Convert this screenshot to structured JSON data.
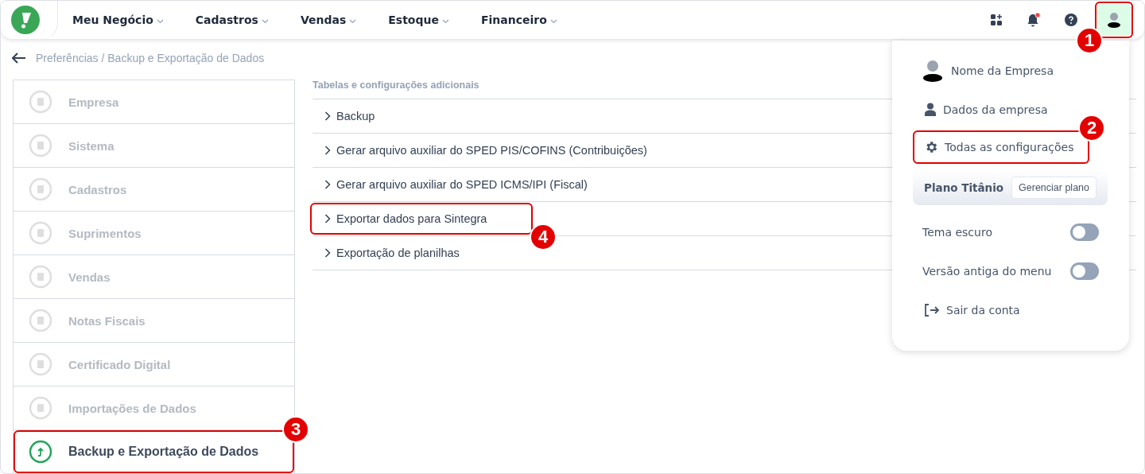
{
  "topbar": {
    "nav": [
      {
        "label": "Meu Negócio"
      },
      {
        "label": "Cadastros"
      },
      {
        "label": "Vendas"
      },
      {
        "label": "Estoque"
      },
      {
        "label": "Financeiro"
      }
    ],
    "notification_unread": true,
    "avatar_callout": "1"
  },
  "breadcrumb": "Preferências / Backup e Exportação de Dados",
  "sidebar": {
    "items": [
      {
        "label": "Empresa",
        "selected": false
      },
      {
        "label": "Sistema",
        "selected": false
      },
      {
        "label": "Cadastros",
        "selected": false
      },
      {
        "label": "Suprimentos",
        "selected": false
      },
      {
        "label": "Vendas",
        "selected": false
      },
      {
        "label": "Notas Fiscais",
        "selected": false
      },
      {
        "label": "Certificado Digital",
        "selected": false
      },
      {
        "label": "Importações de Dados",
        "selected": false
      },
      {
        "label": "Backup e Exportação de Dados",
        "selected": true,
        "callout": "3"
      }
    ]
  },
  "content": {
    "heading": "Tabelas e configurações adicionais",
    "items": [
      {
        "label": "Backup"
      },
      {
        "label": "Gerar arquivo auxiliar do SPED PIS/COFINS (Contribuições)"
      },
      {
        "label": "Gerar arquivo auxiliar do SPED ICMS/IPI (Fiscal)"
      },
      {
        "label": "Exportar dados para Sintegra",
        "callout": "4"
      },
      {
        "label": "Exportação de planilhas"
      }
    ]
  },
  "user_menu": {
    "company": "Nome da Empresa",
    "items": [
      {
        "kind": "profile",
        "label": "Dados da empresa"
      },
      {
        "kind": "settings",
        "label": "Todas as configurações",
        "callout": "2"
      },
      {
        "kind": "plan",
        "label": "Plano Titânio",
        "button": "Gerenciar plano"
      },
      {
        "kind": "toggle",
        "label": "Tema escuro",
        "on": false
      },
      {
        "kind": "toggle",
        "label": "Versão antiga do menu",
        "on": false
      },
      {
        "kind": "logout",
        "label": "Sair da conta"
      }
    ]
  }
}
